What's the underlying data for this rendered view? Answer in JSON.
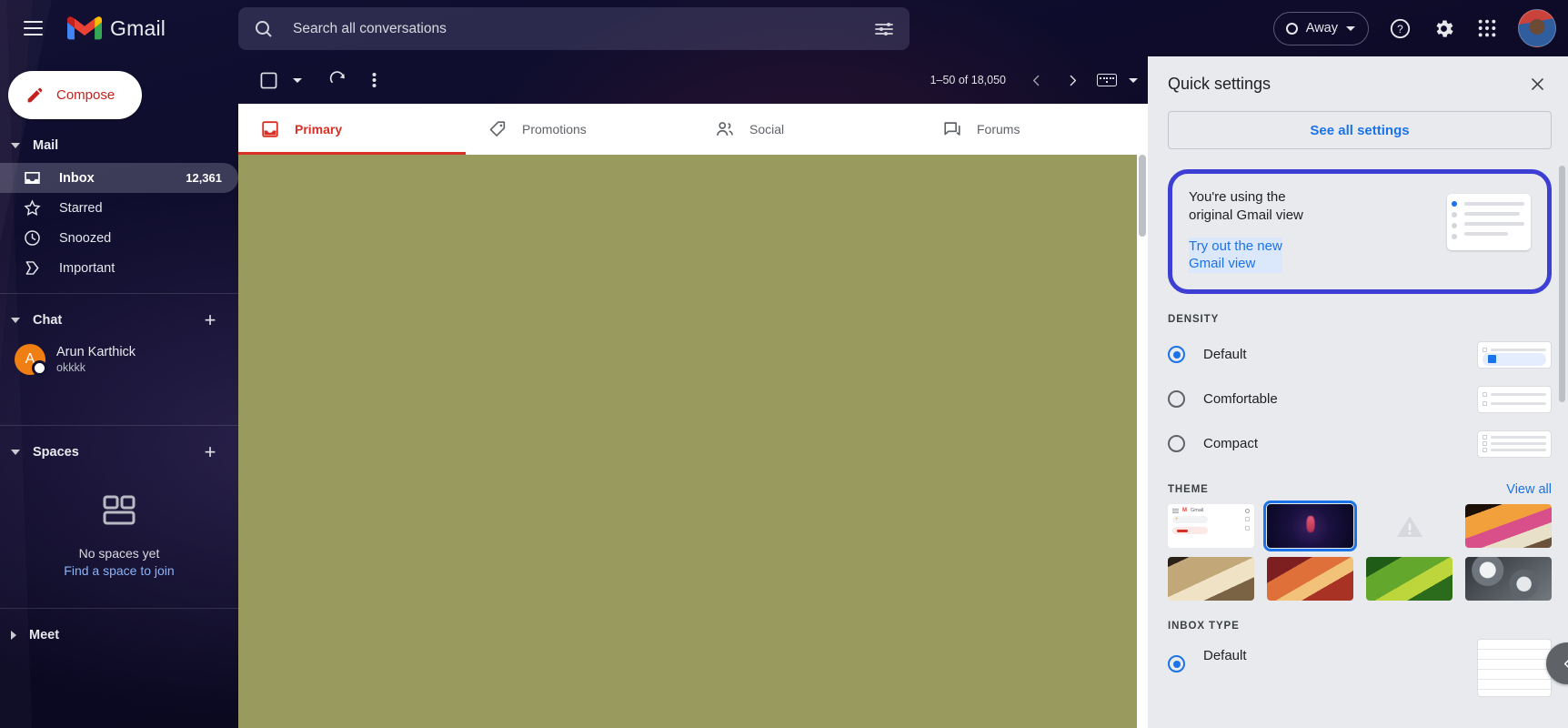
{
  "app": {
    "brand": "Gmail"
  },
  "topbar": {
    "menu_label": "Main menu",
    "status": {
      "label": "Away"
    },
    "help_label": "Support",
    "settings_label": "Settings",
    "apps_label": "Google apps",
    "account_label": "Google Account"
  },
  "search": {
    "placeholder": "Search all conversations",
    "value": "",
    "filter_label": "Show search options"
  },
  "sidebar": {
    "compose": "Compose",
    "mail": {
      "title": "Mail",
      "items": [
        {
          "label": "Inbox",
          "count": "12,361",
          "active": true
        },
        {
          "label": "Starred",
          "count": "",
          "active": false
        },
        {
          "label": "Snoozed",
          "count": "",
          "active": false
        },
        {
          "label": "Important",
          "count": "",
          "active": false
        }
      ]
    },
    "chat": {
      "title": "Chat",
      "add_label": "Start chat",
      "contacts": [
        {
          "initial": "A",
          "name": "Arun Karthick",
          "preview": "okkkk"
        }
      ]
    },
    "spaces": {
      "title": "Spaces",
      "add_label": "Create or find a space",
      "empty_title": "No spaces yet",
      "empty_link": "Find a space to join"
    },
    "meet": {
      "title": "Meet"
    }
  },
  "toolbar": {
    "select_label": "Select",
    "refresh_label": "Refresh",
    "more_label": "More",
    "pagination": "1–50 of 18,050",
    "prev_label": "Newer",
    "next_label": "Older",
    "input_tools_label": "Select input tool"
  },
  "tabs": [
    {
      "label": "Primary",
      "icon": "inbox-icon",
      "active": true
    },
    {
      "label": "Promotions",
      "icon": "tag-icon",
      "active": false
    },
    {
      "label": "Social",
      "icon": "people-icon",
      "active": false
    },
    {
      "label": "Forums",
      "icon": "forum-icon",
      "active": false
    }
  ],
  "quick_settings": {
    "title": "Quick settings",
    "close_label": "Close",
    "see_all": "See all settings",
    "promo": {
      "line1": "You're using the",
      "line2": "original Gmail view",
      "link1": "Try out the new",
      "link2": "Gmail view",
      "border_color": "#3d3fd4"
    },
    "density": {
      "label": "DENSITY",
      "options": [
        {
          "label": "Default",
          "selected": true
        },
        {
          "label": "Comfortable",
          "selected": false
        },
        {
          "label": "Compact",
          "selected": false
        }
      ]
    },
    "theme": {
      "label": "THEME",
      "view_all": "View all",
      "thumbs": [
        {
          "name": "theme-light-gmail",
          "selected": false
        },
        {
          "name": "theme-dark-figure",
          "selected": true
        },
        {
          "name": "theme-unavailable-warning",
          "selected": false
        },
        {
          "name": "theme-deity-art",
          "selected": false
        },
        {
          "name": "theme-chess",
          "selected": false
        },
        {
          "name": "theme-canyon",
          "selected": false
        },
        {
          "name": "theme-leaf",
          "selected": false
        },
        {
          "name": "theme-spheres",
          "selected": false
        }
      ]
    },
    "inbox_type": {
      "label": "INBOX TYPE",
      "options": [
        {
          "label": "Default",
          "selected": true
        }
      ]
    },
    "collapse_label": "Hide side panel"
  },
  "colors": {
    "accent_red": "#d93025",
    "accent_blue": "#1a73e8",
    "promo_border": "#3d3fd4",
    "content_olive": "#999a5e",
    "panel_bg": "#e9eaee"
  }
}
